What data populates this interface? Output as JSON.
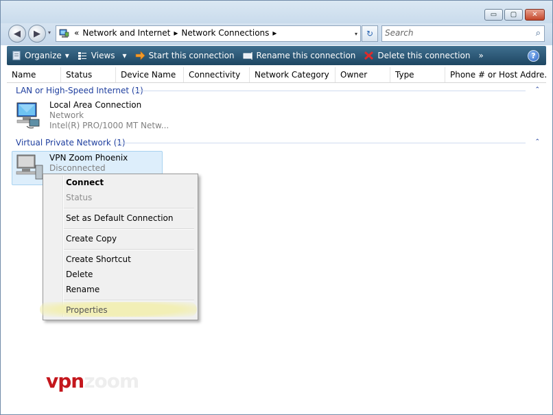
{
  "window": {
    "controls": {
      "minimize": "▭",
      "maximize": "▢",
      "close": "✕"
    }
  },
  "nav": {
    "back": "◀",
    "forward": "▶",
    "history": "▾"
  },
  "address": {
    "crumbs": [
      "Network and Internet",
      "Network Connections"
    ],
    "lead": "«",
    "separator": "▸",
    "dropdown": "▾",
    "refresh": "↻"
  },
  "search": {
    "placeholder": "Search",
    "icon": "⌕"
  },
  "toolbar": {
    "organize": "Organize",
    "views": "Views",
    "start": "Start this connection",
    "rename": "Rename this connection",
    "delete": "Delete this connection",
    "more": "»",
    "help": "?",
    "dropdown": "▾"
  },
  "columns": [
    "Name",
    "Status",
    "Device Name",
    "Connectivity",
    "Network Category",
    "Owner",
    "Type",
    "Phone # or Host Addre..."
  ],
  "groups": [
    {
      "title": "LAN or High-Speed Internet (1)",
      "collapse": "⌃",
      "items": [
        {
          "name": "Local Area Connection",
          "line1": "Network",
          "line2": "Intel(R) PRO/1000 MT Netw..."
        }
      ]
    },
    {
      "title": "Virtual Private Network (1)",
      "collapse": "⌃",
      "items": [
        {
          "name": "VPN Zoom Phoenix",
          "line1": "Disconnected"
        }
      ]
    }
  ],
  "context_menu": {
    "connect": "Connect",
    "status": "Status",
    "set_default": "Set as Default Connection",
    "create_copy": "Create Copy",
    "create_shortcut": "Create Shortcut",
    "delete": "Delete",
    "rename": "Rename",
    "properties": "Properties"
  },
  "watermark": {
    "vpn": "vpn",
    "domain": "zoom"
  },
  "colors": {
    "toolbar": "#1e4662",
    "group_title": "#1e3e9e",
    "watermark_red": "#c4171d",
    "highlight": "#f1efb8"
  }
}
